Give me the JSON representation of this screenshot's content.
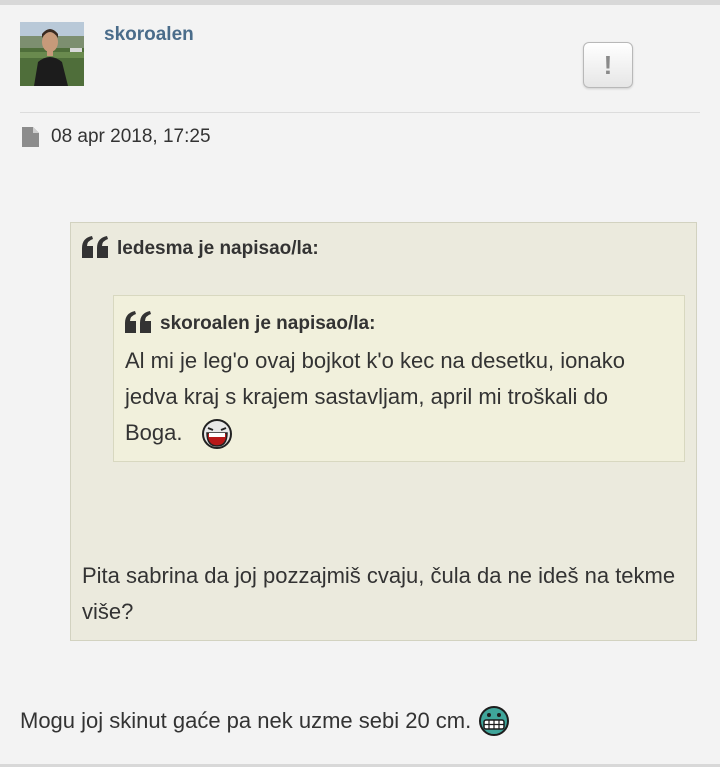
{
  "post": {
    "username": "skoroalen",
    "report_label": "!",
    "date": "08 apr 2018, 17:25",
    "icons": {
      "avatar": "avatar-photo",
      "report": "exclamation-icon",
      "date": "file-icon",
      "quote": "quote-icon"
    }
  },
  "quote_outer": {
    "author": "ledesma je napisao/la:",
    "text": "Pita sabrina da joj pozzajmiš cvaju, čula da ne ideš na tekme više?"
  },
  "quote_inner": {
    "author": "skoroalen je napisao/la:",
    "text": "Al mi je leg'o ovaj bojkot k'o kec na desetku, ionako jedva kraj s krajem sastavljam, april mi troškali do Boga.",
    "smiley": "laughing-smiley-icon"
  },
  "message": {
    "text": "Mogu joj skinut gaće pa nek uzme sebi 20 cm.",
    "smiley": "grinning-smiley-icon"
  },
  "colors": {
    "username": "#4a6c8a",
    "quote_outer_bg": "#ebeadd",
    "quote_inner_bg": "#f1f0dc",
    "page_bg": "#f3f3f3"
  }
}
